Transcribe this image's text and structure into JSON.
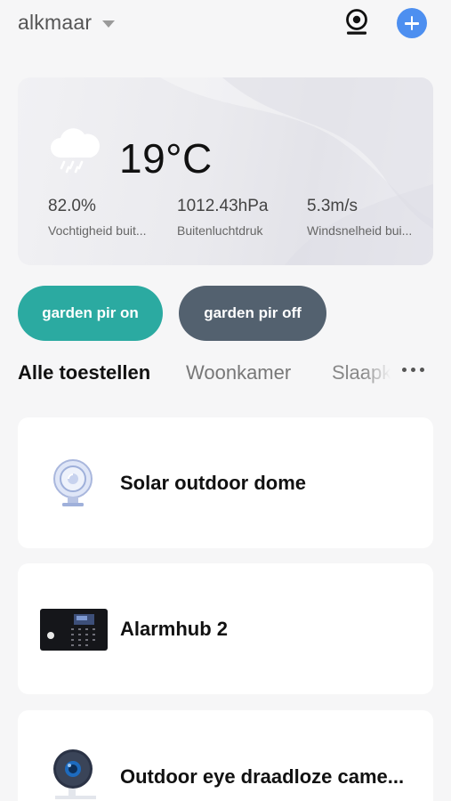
{
  "header": {
    "home_name": "alkmaar",
    "icons": [
      "chevron-down-icon",
      "camera-icon",
      "plus-icon"
    ],
    "accent_color": "#4d8ff0"
  },
  "weather": {
    "icon": "rain-cloud-icon",
    "temperature": "19°C",
    "humidity_value": "82.0%",
    "humidity_label": "Vochtigheid buit...",
    "pressure_value": "1012.43hPa",
    "pressure_label": "Buitenluchtdruk",
    "wind_value": "5.3m/s",
    "wind_label": "Windsnelheid bui..."
  },
  "scenes": [
    {
      "label": "garden pir on",
      "color": "#2baaa1"
    },
    {
      "label": "garden pir off",
      "color": "#53616f"
    }
  ],
  "tabs": {
    "items": [
      "Alle toestellen",
      "Woonkamer",
      "Slaapkamer"
    ],
    "active": "Alle toestellen",
    "more_icon": "more-dots-icon"
  },
  "devices": [
    {
      "name": "Solar outdoor dome",
      "icon": "dome-camera-icon"
    },
    {
      "name": "Alarmhub 2",
      "icon": "alarm-hub-icon"
    },
    {
      "name": "Outdoor eye draadloze came...",
      "icon": "outdoor-camera-icon"
    }
  ]
}
